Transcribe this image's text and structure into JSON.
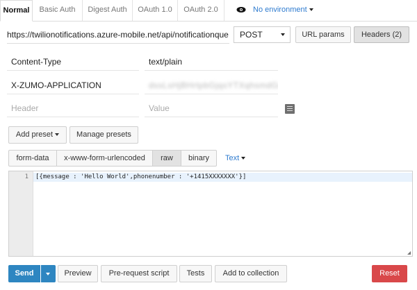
{
  "tabs": [
    "Normal",
    "Basic Auth",
    "Digest Auth",
    "OAuth 1.0",
    "OAuth 2.0"
  ],
  "environment": {
    "label": "No environment",
    "icon": "eye-icon"
  },
  "request": {
    "url": "https://twilionotifications.azure-mobile.net/api/notificationque",
    "method": "POST",
    "url_params_label": "URL params",
    "headers_label": "Headers (2)"
  },
  "headers": [
    {
      "key": "Content-Type",
      "value": "text/plain"
    },
    {
      "key": "X-ZUMO-APPLICATION",
      "value": "dssLsHjBHrtpbGjqsYTXqhsmdGaGx"
    }
  ],
  "new_header": {
    "key_placeholder": "Header",
    "value_placeholder": "Value"
  },
  "presets": {
    "add_label": "Add preset",
    "manage_label": "Manage presets"
  },
  "body_modes": [
    "form-data",
    "x-www-form-urlencoded",
    "raw",
    "binary"
  ],
  "body_active": "raw",
  "text_mode": "Text",
  "editor": {
    "line_number": "1",
    "content": "[{message : 'Hello World',phonenumber : '+1415XXXXXXX'}]"
  },
  "actions": {
    "send": "Send",
    "preview": "Preview",
    "prerequest": "Pre-request script",
    "tests": "Tests",
    "add_collection": "Add to collection",
    "reset": "Reset"
  },
  "colors": {
    "primary": "#2e86c1",
    "danger": "#d9484a",
    "link": "#2e7bcf"
  }
}
